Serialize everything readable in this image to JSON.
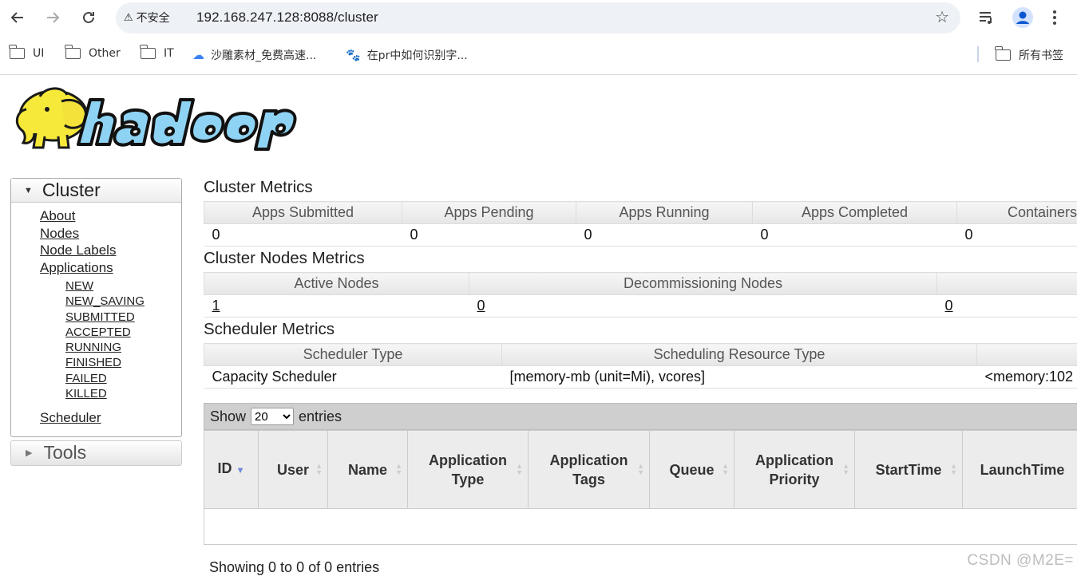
{
  "browser": {
    "security_label": "不安全",
    "url": "192.168.247.128:8088/cluster",
    "bookmarks": [
      "UI",
      "Other",
      "IT",
      "沙雕素材_免费高速...",
      "在pr中如何识别字..."
    ],
    "all_bookmarks": "所有书签"
  },
  "sidebar": {
    "cluster_title": "Cluster",
    "links": [
      "About",
      "Nodes",
      "Node Labels",
      "Applications"
    ],
    "app_states": [
      "NEW",
      "NEW_SAVING",
      "SUBMITTED",
      "ACCEPTED",
      "RUNNING",
      "FINISHED",
      "FAILED",
      "KILLED"
    ],
    "scheduler_link": "Scheduler",
    "tools_title": "Tools"
  },
  "cluster_metrics": {
    "title": "Cluster Metrics",
    "headers": [
      "Apps Submitted",
      "Apps Pending",
      "Apps Running",
      "Apps Completed",
      "Containers"
    ],
    "values": [
      "0",
      "0",
      "0",
      "0",
      "0"
    ]
  },
  "nodes_metrics": {
    "title": "Cluster Nodes Metrics",
    "headers": [
      "Active Nodes",
      "Decommissioning Nodes",
      ""
    ],
    "values": [
      "1",
      "0",
      "0"
    ]
  },
  "scheduler_metrics": {
    "title": "Scheduler Metrics",
    "headers": [
      "Scheduler Type",
      "Scheduling Resource Type",
      ""
    ],
    "values": [
      "Capacity Scheduler",
      "[memory-mb (unit=Mi), vcores]",
      "<memory:102"
    ]
  },
  "apps_table": {
    "show_label": "Show",
    "page_size": "20",
    "entries_label": "entries",
    "headers": [
      "ID",
      "User",
      "Name",
      "Application Type",
      "Application Tags",
      "Queue",
      "Application Priority",
      "StartTime",
      "LaunchTime"
    ],
    "info": "Showing 0 to 0 of 0 entries"
  },
  "watermark": "CSDN @M2E="
}
